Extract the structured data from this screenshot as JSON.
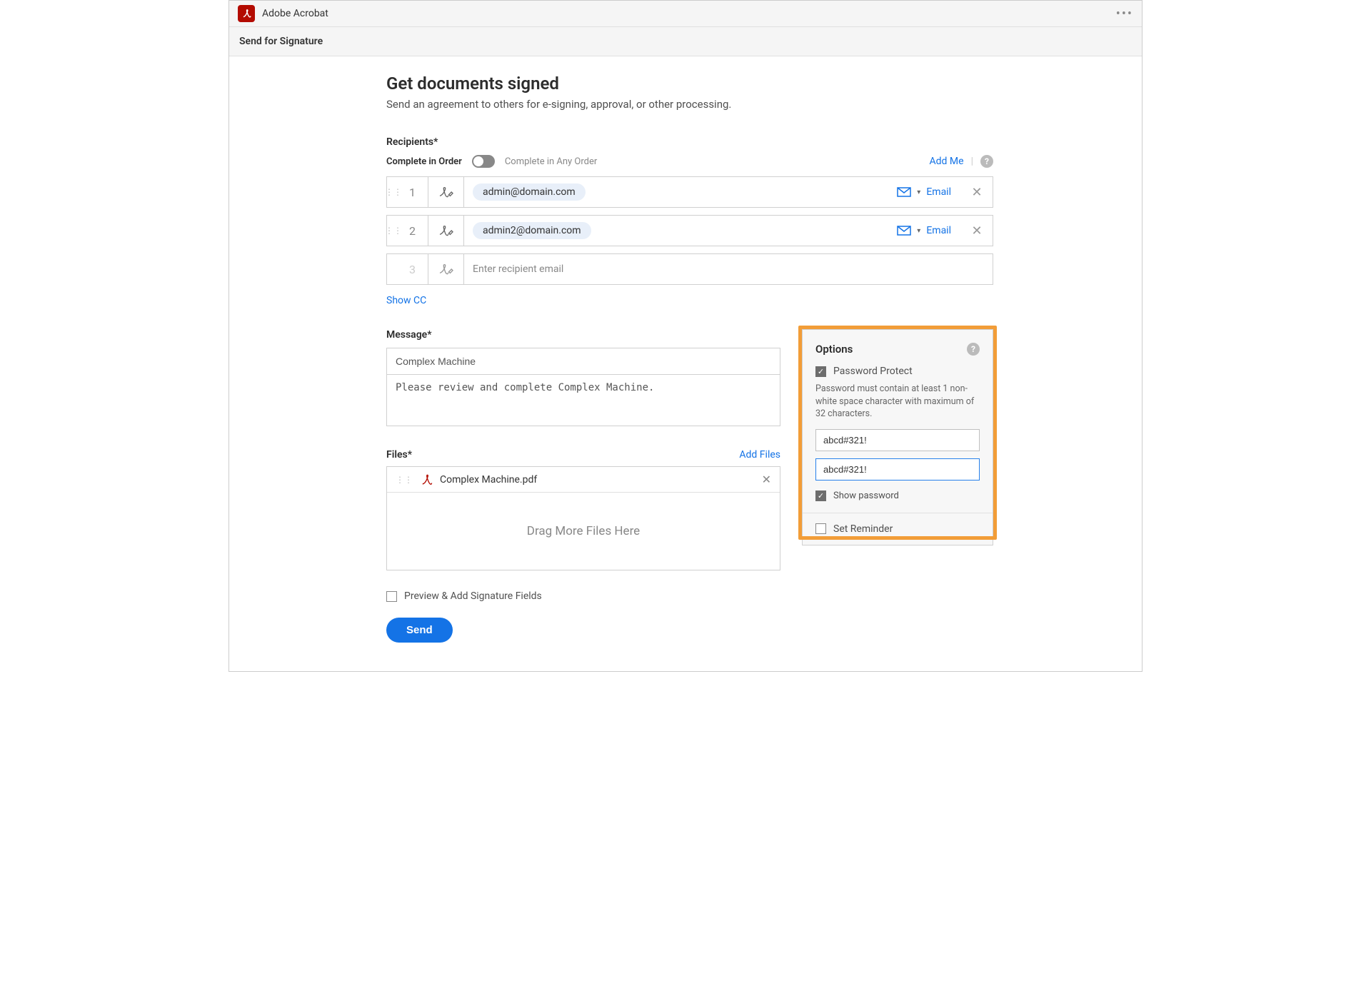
{
  "app": {
    "title": "Adobe Acrobat",
    "subheader": "Send for Signature"
  },
  "page": {
    "title": "Get documents signed",
    "subtitle": "Send an agreement to others for e-signing, approval, or other processing."
  },
  "recipients": {
    "label": "Recipients*",
    "complete_in_order": "Complete in Order",
    "complete_any_order": "Complete in Any Order",
    "add_me": "Add Me",
    "rows": [
      {
        "num": "1",
        "email": "admin@domain.com",
        "method": "Email"
      },
      {
        "num": "2",
        "email": "admin2@domain.com",
        "method": "Email"
      },
      {
        "num": "3",
        "placeholder": "Enter recipient email"
      }
    ],
    "show_cc": "Show CC"
  },
  "message": {
    "label": "Message*",
    "subject": "Complex Machine",
    "body": "Please review and complete Complex Machine."
  },
  "files": {
    "label": "Files*",
    "add_files": "Add Files",
    "items": [
      {
        "name": "Complex Machine.pdf"
      }
    ],
    "drop_text": "Drag More Files Here"
  },
  "options": {
    "title": "Options",
    "password_protect": "Password Protect",
    "password_hint": "Password must contain at least 1 non-white space character with maximum of 32 characters.",
    "pwd1": "abcd#321!",
    "pwd2": "abcd#321!",
    "show_password": "Show password",
    "set_reminder": "Set Reminder"
  },
  "footer": {
    "preview": "Preview & Add Signature Fields",
    "send": "Send"
  }
}
